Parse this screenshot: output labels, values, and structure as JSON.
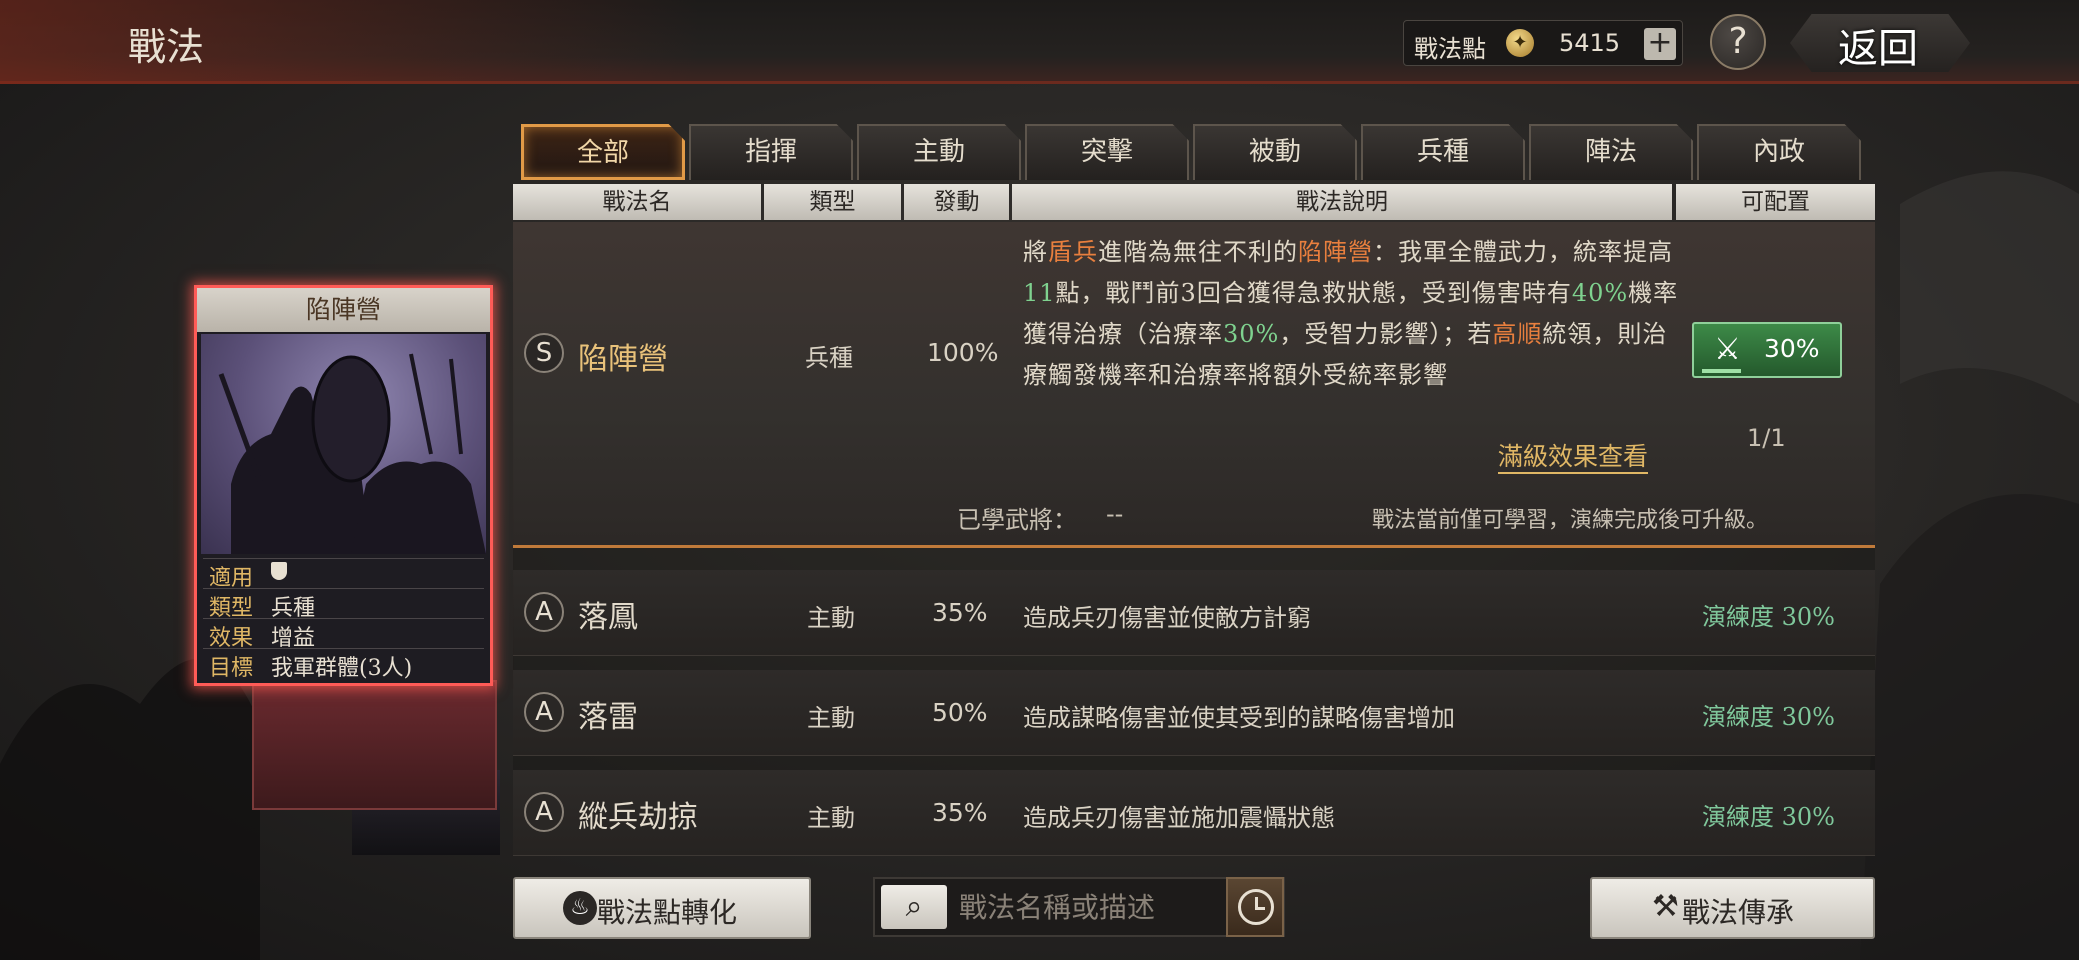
{
  "header": {
    "title": "戰法",
    "points_label": "戰法點",
    "points_icon": "coin-icon",
    "points_value": "5415",
    "add_symbol": "+",
    "help_symbol": "?",
    "back_label": "返回"
  },
  "tabs": [
    {
      "label": "全部",
      "active": true
    },
    {
      "label": "指揮"
    },
    {
      "label": "主動"
    },
    {
      "label": "突擊"
    },
    {
      "label": "被動"
    },
    {
      "label": "兵種"
    },
    {
      "label": "陣法"
    },
    {
      "label": "內政"
    }
  ],
  "columns": [
    "戰法名",
    "類型",
    "發動",
    "戰法說明",
    "可配置"
  ],
  "expanded": {
    "grade": "S",
    "name": "陷陣營",
    "type": "兵種",
    "rate": "100%",
    "desc": {
      "p1": "將",
      "h1": "盾兵",
      "p2": "進階為無往不利的",
      "h2": "陷陣營",
      "p3": "：我軍全體武力，統率提高",
      "h3": "11",
      "p4": "點，戰鬥前3回合獲得急救狀態，受到傷害時有",
      "h4": "40%",
      "p5": "機率獲得治療（治療率",
      "h5": "30%",
      "p6": "，受智力影響）；若",
      "h6": "高順",
      "p7": "統領，則治療觸發機率和治療率將額外受統率影響"
    },
    "full_effect_link": "滿級效果查看",
    "config_percent": "30%",
    "config_progress": 0.3,
    "config_count": "1/1",
    "learned_label": "已學武將：",
    "learned_value": "--",
    "note": "戰法當前僅可學習，演練完成後可升級。"
  },
  "rows": [
    {
      "grade": "A",
      "name": "落鳳",
      "type": "主動",
      "rate": "35%",
      "desc": "造成兵刃傷害並使敵方計窮",
      "skill": "演練度 30%"
    },
    {
      "grade": "A",
      "name": "落雷",
      "type": "主動",
      "rate": "50%",
      "desc": "造成謀略傷害並使其受到的謀略傷害增加",
      "skill": "演練度 30%"
    },
    {
      "grade": "A",
      "name": "縱兵劫掠",
      "type": "主動",
      "rate": "35%",
      "desc": "造成兵刃傷害並施加震懾狀態",
      "skill": "演練度 30%"
    }
  ],
  "card": {
    "title": "陷陣營",
    "attrs": [
      {
        "label": "適用",
        "value": "",
        "icon": "shield-icon"
      },
      {
        "label": "類型",
        "value": "兵種"
      },
      {
        "label": "效果",
        "value": "增益"
      },
      {
        "label": "目標",
        "value": "我軍群體(3人)"
      }
    ],
    "border_color": "#ff5b57"
  },
  "bottom": {
    "convert_label": "戰法點轉化",
    "search_placeholder": "戰法名稱或描述",
    "inherit_label": "戰法傳承"
  },
  "colors": {
    "accent_orange": "#e87f3e",
    "accent_green": "#7fd28f",
    "active_tab": "#e19a47"
  }
}
